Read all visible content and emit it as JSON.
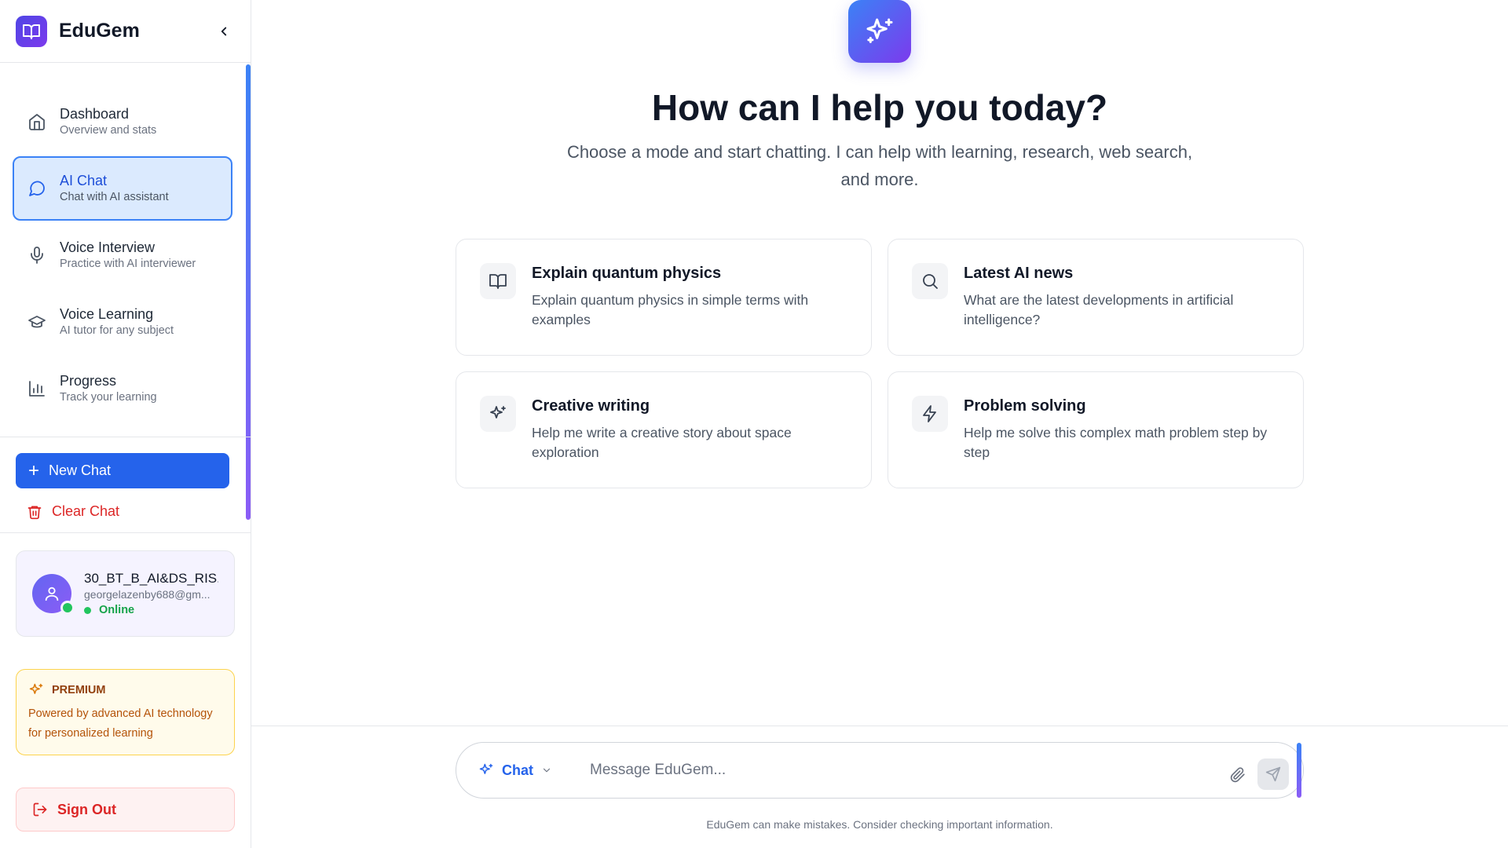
{
  "app": {
    "name": "EduGem"
  },
  "sidebar": {
    "items": [
      {
        "title": "Dashboard",
        "subtitle": "Overview and stats",
        "icon": "home-icon"
      },
      {
        "title": "AI Chat",
        "subtitle": "Chat with AI assistant",
        "icon": "chat-icon",
        "active": true
      },
      {
        "title": "Voice Interview",
        "subtitle": "Practice with AI interviewer",
        "icon": "microphone-icon"
      },
      {
        "title": "Voice Learning",
        "subtitle": "AI tutor for any subject",
        "icon": "graduation-cap-icon"
      },
      {
        "title": "Progress",
        "subtitle": "Track your learning",
        "icon": "bar-chart-icon"
      }
    ],
    "new_chat_label": "New Chat",
    "clear_chat_label": "Clear Chat",
    "user": {
      "name": "30_BT_B_AI&DS_RIS...",
      "email": "georgelazenby688@gm...",
      "status": "Online"
    },
    "premium": {
      "title": "PREMIUM",
      "text": "Powered by advanced AI technology for personalized learning"
    },
    "signout_label": "Sign Out"
  },
  "main": {
    "title": "How can I help you today?",
    "subtitle": "Choose a mode and start chatting. I can help with learning, research, web search, and more.",
    "cards": [
      {
        "title": "Explain quantum physics",
        "desc": "Explain quantum physics in simple terms with examples",
        "icon": "book-icon"
      },
      {
        "title": "Latest AI news",
        "desc": "What are the latest developments in artificial intelligence?",
        "icon": "search-icon"
      },
      {
        "title": "Creative writing",
        "desc": "Help me write a creative story about space exploration",
        "icon": "sparkles-icon"
      },
      {
        "title": "Problem solving",
        "desc": "Help me solve this complex math problem step by step",
        "icon": "lightning-icon"
      }
    ],
    "composer": {
      "mode_label": "Chat",
      "placeholder": "Message EduGem..."
    },
    "disclaimer": "EduGem can make mistakes. Consider checking important information."
  },
  "colors": {
    "accent": "#2563eb",
    "danger": "#dc2626",
    "online": "#22c55e",
    "premium": "#92400e"
  }
}
